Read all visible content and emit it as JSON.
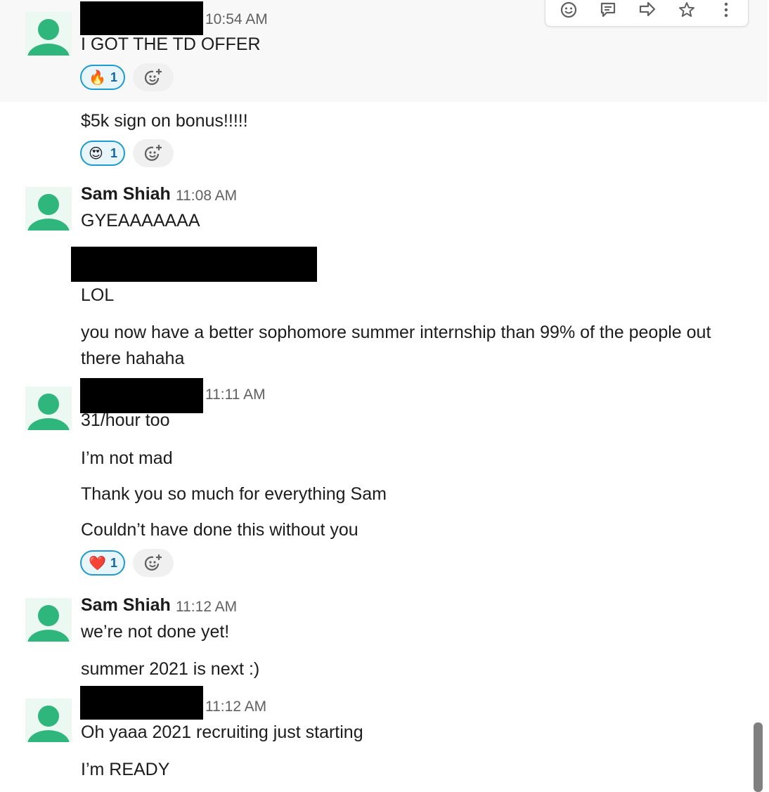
{
  "toolbar": {
    "icons": [
      "add-reaction-icon",
      "reply-thread-icon",
      "share-icon",
      "bookmark-star-icon",
      "more-actions-icon"
    ]
  },
  "messages": [
    {
      "time": "10:54 AM",
      "lines": [
        "I GOT THE TD OFFER"
      ],
      "reaction": {
        "emoji": "🔥",
        "count": "1"
      }
    },
    {
      "lines": [
        "$5k sign on bonus!!!!!"
      ],
      "reaction": {
        "emoji": "😍",
        "count": "1"
      }
    },
    {
      "author": "Sam Shiah",
      "time": "11:08 AM",
      "lines": [
        "GYEAAAAAAA"
      ]
    },
    {
      "lines": [
        "LOL",
        "you now have a better sophomore summer internship than 99% of the people out there hahaha"
      ]
    },
    {
      "time": "11:11 AM",
      "lines": [
        "31/hour too",
        "I’m not mad",
        "Thank you so much for everything Sam",
        "Couldn’t have done this without you"
      ],
      "reaction": {
        "emoji": "❤️",
        "count": "1"
      }
    },
    {
      "author": "Sam Shiah",
      "time": "11:12 AM",
      "lines": [
        "we’re not done yet!",
        "summer 2021 is next :)"
      ]
    },
    {
      "time": "11:12 AM",
      "lines": [
        "Oh yaaa 2021 recruiting just starting",
        "I’m READY"
      ]
    }
  ]
}
